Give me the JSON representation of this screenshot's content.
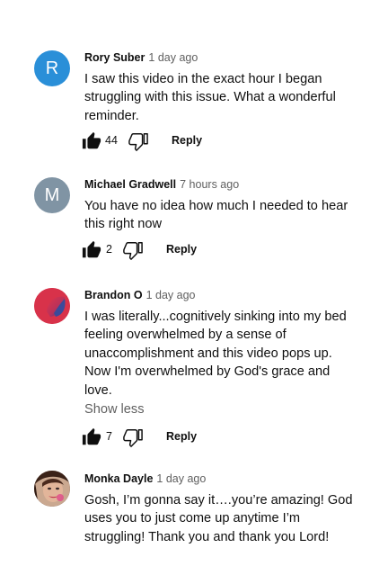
{
  "comments": [
    {
      "author": "Rory Suber",
      "time": "1 day ago",
      "avatar_letter": "R",
      "avatar_color": "#2a8fd8",
      "lines": [
        "I saw this video in the exact hour I began",
        "struggling with this issue. What a wonderful",
        "reminder."
      ],
      "likes": "44",
      "reply_label": "Reply"
    },
    {
      "author": "Michael Gradwell",
      "time": "7 hours ago",
      "avatar_letter": "M",
      "avatar_color": "#8094a4",
      "lines": [
        "You have no idea how much I needed to hear",
        "this right now"
      ],
      "likes": "2",
      "reply_label": "Reply"
    },
    {
      "author": "Brandon O",
      "time": "1 day ago",
      "avatar_letter": "",
      "avatar_color": "#d8324a",
      "lines": [
        "I was literally...cognitively sinking into my bed",
        "feeling overwhelmed by a sense of",
        "unaccomplishment and this video pops up.",
        "Now I'm overwhelmed by God's grace and",
        "love."
      ],
      "show_less": "Show less",
      "likes": "7",
      "reply_label": "Reply"
    },
    {
      "author": "Monka Dayle",
      "time": "1 day ago",
      "avatar_letter": "",
      "avatar_color": "#6b4a3a",
      "lines": [
        "Gosh, I’m gonna say it….you’re amazing!  God",
        "uses you to just come up anytime I’m",
        "struggling!  Thank you and thank you Lord!"
      ]
    }
  ]
}
